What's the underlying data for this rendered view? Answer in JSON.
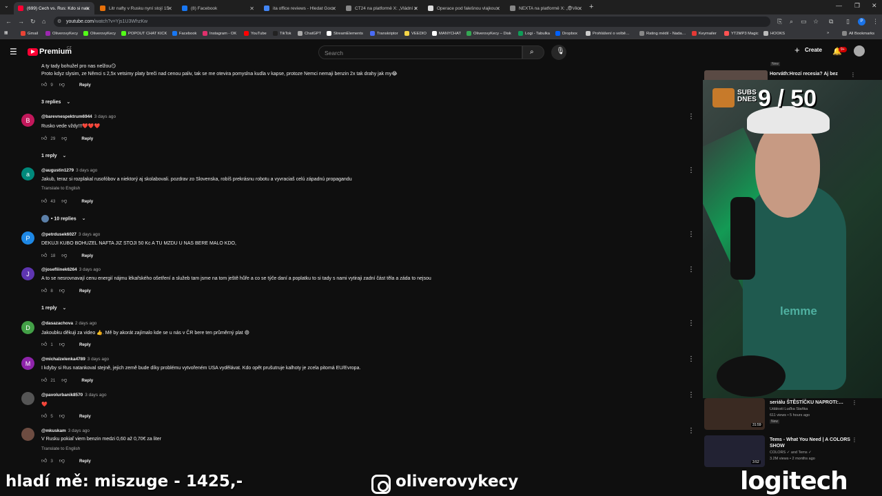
{
  "browser": {
    "tabs": [
      {
        "title": "(699) Čech vs. Rus: Kdo si nata…",
        "fav_color": "#ff0033",
        "active": true
      },
      {
        "title": "Litr nafty v Rusku nyní stojí 15 …",
        "fav_color": "#e8710a",
        "active": false
      },
      {
        "title": "(8) Facebook",
        "fav_color": "#1877f2",
        "active": false
      },
      {
        "title": "ita office reviews - Hledat Goo…",
        "fav_color": "#4285f4",
        "active": false
      },
      {
        "title": "ČT24 na platformě X: „Vládní zm…",
        "fav_color": "#888888",
        "active": false
      },
      {
        "title": "Operace pod falešnou vlajkou …",
        "fav_color": "#dddddd",
        "active": false
      },
      {
        "title": "NEXTA na platformě X: „😨Vik…",
        "fav_color": "#888888",
        "active": false
      }
    ],
    "new_tab": "+",
    "url_host": "youtube.com",
    "url_path": "/watch?v=Yjs1U3WhzKw",
    "bookmarks": [
      {
        "label": "Gmail",
        "color": "#ea4335"
      },
      {
        "label": "OliverovyKecy",
        "color": "#9c27b0"
      },
      {
        "label": "OliverovyKecy",
        "color": "#53fc18"
      },
      {
        "label": "POPOUT CHAT KICK",
        "color": "#53fc18"
      },
      {
        "label": "Facebook",
        "color": "#1877f2"
      },
      {
        "label": "Instagram - OK",
        "color": "#e1306c"
      },
      {
        "label": "YouTube",
        "color": "#ff0000"
      },
      {
        "label": "TikTok",
        "color": "#222222"
      },
      {
        "label": "ChatGPT",
        "color": "#aaaaaa"
      },
      {
        "label": "StreamElements",
        "color": "#ffffff"
      },
      {
        "label": "Transkriptor",
        "color": "#4a6cf7"
      },
      {
        "label": "VEEDIO",
        "color": "#f5d547"
      },
      {
        "label": "MANYCHAT",
        "color": "#ffffff"
      },
      {
        "label": "OliverovyKecy – Disk",
        "color": "#34a853"
      },
      {
        "label": "Logi - Tabulka",
        "color": "#0f9d58"
      },
      {
        "label": "Dropbox",
        "color": "#0061ff"
      },
      {
        "label": "Prohlášení o volbě…",
        "color": "#cccccc"
      },
      {
        "label": "Rating médií - Nada…",
        "color": "#888888"
      },
      {
        "label": "Keymailer",
        "color": "#e53935"
      },
      {
        "label": "YT2MP3 Magic",
        "color": "#ff5252"
      },
      {
        "label": "HOOKS",
        "color": "#bbbbbb"
      }
    ],
    "all_bookmarks": "All Bookmarks"
  },
  "youtube": {
    "logo": "Premium",
    "logo_region": "CZ",
    "search_placeholder": "Search",
    "create_label": "Create",
    "notif_count": "9+"
  },
  "comments": [
    {
      "text_lines": [
        "A ty tady bohužel pro nas nelžou😏",
        "Proto kdyz slysim, ze Němci s 2,5x vetsimy platy breči nad cenou paliv, tak se me otevira pomyslna kudla v kapse, protoze Nemci nemaji benzin 2x tak drahy jak my😂"
      ],
      "likes": "9",
      "reply": "Reply",
      "replies": "3 replies"
    },
    {
      "handle": "@barevnespektrum6944",
      "time": "3 days ago",
      "avatar_letter": "B",
      "avatar_color": "#c2185b",
      "text_lines": [
        "Rusko vede vždy!!!❤️❤️❤️"
      ],
      "likes": "29",
      "reply": "Reply",
      "replies": "1 reply"
    },
    {
      "handle": "@augustin1279",
      "time": "3 days ago",
      "avatar_letter": "a",
      "avatar_color": "#00897b",
      "text_lines": [
        "Jakub, teraz si rozplakal rusofóbov a niektorý aj skolabovali. pozdrav zo Slovenska, robíš prekrásnu robotu a vyvraciaš celú západnú propagandu"
      ],
      "translate": "Translate to English",
      "likes": "43",
      "reply": "Reply",
      "replies": "• 10 replies"
    },
    {
      "handle": "@petrdusek6027",
      "time": "3 days ago",
      "avatar_letter": "P",
      "avatar_color": "#1e88e5",
      "text_lines": [
        "DEKUJI  KUBO  BOHUZEL   NAFTA  JIZ STOJI 50 Kc      A TU MZDU  U NAS BERE MALO KDO,"
      ],
      "likes": "18",
      "reply": "Reply"
    },
    {
      "handle": "@josefliinek6264",
      "time": "3 days ago",
      "avatar_letter": "J",
      "avatar_color": "#5e35b1",
      "text_lines": [
        "A to se nesrovnavají cenu energií nájmu lékařského ošetření a služeb tam jsme na tom ještě hůře a co se týče daní a poplatku to si tady s nami vytiraji zadní část těla a záda to nejsou"
      ],
      "likes": "8",
      "reply": "Reply",
      "replies": "1 reply"
    },
    {
      "handle": "@dasazachova",
      "time": "2 days ago",
      "avatar_letter": "D",
      "avatar_color": "#43a047",
      "text_lines": [
        "Jakoubku děkuji za video 👍. Mě by akorát zajímalo kde se u nás v ČR bere ten průměrný plat 😄"
      ],
      "likes": "1",
      "reply": "Reply"
    },
    {
      "handle": "@michalzelenka4789",
      "time": "3 days ago",
      "avatar_letter": "M",
      "avatar_color": "#8e24aa",
      "text_lines": [
        "I kdyby si Rus natankoval stejně, jejich země bude díky problému vytvořeném USA vydělávat. Kdo opět prušutruje kalhoty je zcela pitomá EU/Evropa."
      ],
      "likes": "21",
      "reply": "Reply"
    },
    {
      "handle": "@pavolurbanik8570",
      "time": "3 days ago",
      "avatar_letter": "",
      "avatar_color": "#555555",
      "text_lines": [
        "❤️"
      ],
      "likes": "5",
      "reply": "Reply"
    },
    {
      "handle": "@mkuskam",
      "time": "3 days ago",
      "avatar_letter": "",
      "avatar_color": "#6d4c41",
      "text_lines": [
        "V Rusku pokiaľ viem benzin medzi 0,60 až 0,70€ za liter"
      ],
      "translate": "Translate to English",
      "likes": "3",
      "reply": "Reply"
    }
  ],
  "sidebar": {
    "top_video": {
      "title": "Horváth:Hrozí recesia? Aj bez",
      "badge": "New"
    },
    "videos": [
      {
        "title": "seriálu ŠTĚSTÍČKU NAPROTI:…",
        "channel": "Události Luďka Staňka",
        "meta": "611 views • 5 hours ago",
        "badge": "New",
        "duration": "31:59",
        "thumb_color": "#3a2a22"
      },
      {
        "title": "Tems - What You Need | A COLORS SHOW",
        "channel": "COLORS ✓ and Tems ✓",
        "meta": "3.2M views • 2 months ago",
        "duration": "3:52",
        "thumb_color": "#222233"
      }
    ]
  },
  "webcam": {
    "subs_counter": "9 / 50",
    "subs_label_1": "SUBS",
    "subs_label_2": "DNES",
    "shirt_text": "lemme"
  },
  "overlay": {
    "left_text": "hladí mě: miszuge - 1425,-",
    "mid_text": "oliverovykecy",
    "right_text": "logitech"
  }
}
